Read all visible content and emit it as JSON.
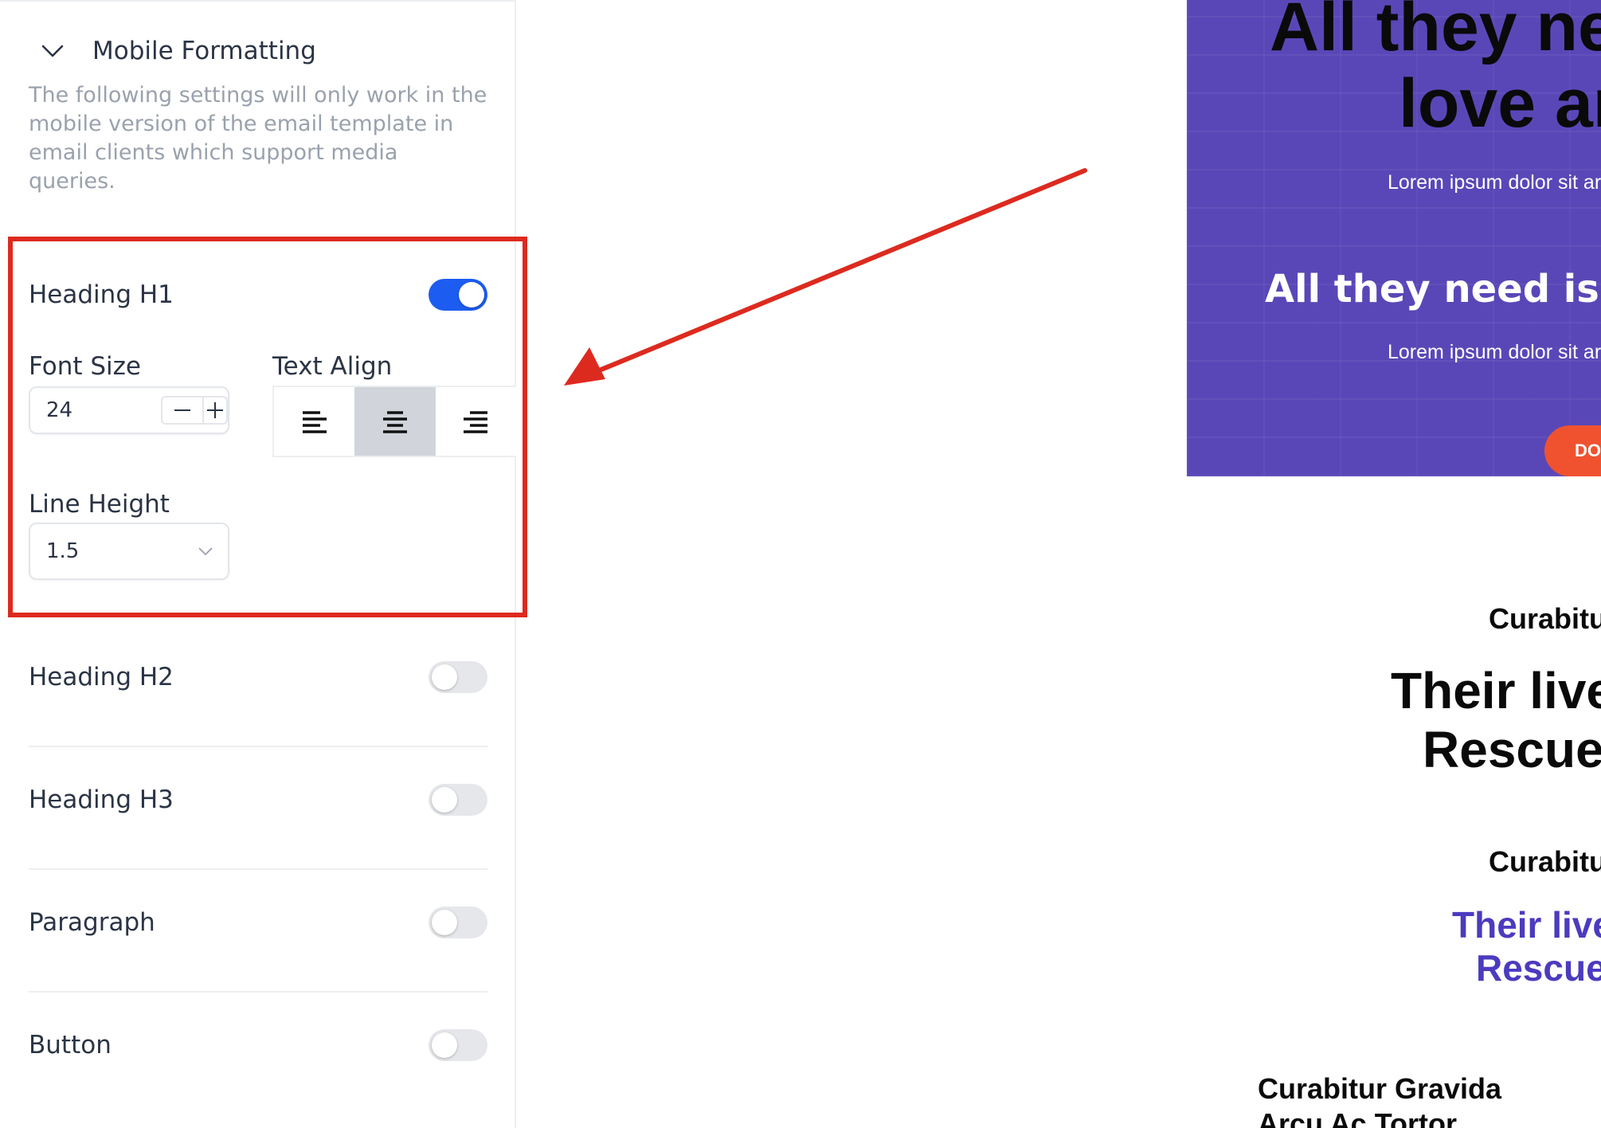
{
  "sidebar": {
    "section_title": "Mobile Formatting",
    "section_description": "The following settings will only work in the mobile version of the email template in email clients which support media queries.",
    "heading_h1": {
      "label": "Heading H1",
      "enabled": true,
      "font_size_label": "Font Size",
      "font_size_value": "24",
      "text_align_label": "Text Align",
      "text_align_options": [
        "left",
        "center",
        "right"
      ],
      "text_align_selected": "center",
      "line_height_label": "Line Height",
      "line_height_value": "1.5"
    },
    "toggles": [
      {
        "label": "Heading H2",
        "enabled": false
      },
      {
        "label": "Heading H3",
        "enabled": false
      },
      {
        "label": "Paragraph",
        "enabled": false
      },
      {
        "label": "Button",
        "enabled": false
      }
    ]
  },
  "preview": {
    "hero_heading_line1": "All they ne",
    "hero_heading_line2": "love ar",
    "hero_sub_1": "Lorem ipsum dolor sit ar",
    "hero_heading_2": "All they need is y",
    "hero_sub_2": "Lorem ipsum dolor sit ar",
    "donate_button": "DO",
    "small_heading_1": "Curabitu",
    "big_heading_line1": "Their live",
    "big_heading_line2": "Rescue",
    "small_heading_2": "Curabitu",
    "purple_heading_line1": "Their live",
    "purple_heading_line2": "Rescue",
    "bottom_heading_line1": "Curabitur Gravida",
    "bottom_heading_line2": "Arcu Ac Tortor"
  },
  "colors": {
    "accent": "#1d5cf0",
    "highlight_border": "#dd2a1f",
    "hero_background": "#5a47b7",
    "donate_button": "#f0522f",
    "purple_text": "#4b3bbf"
  }
}
